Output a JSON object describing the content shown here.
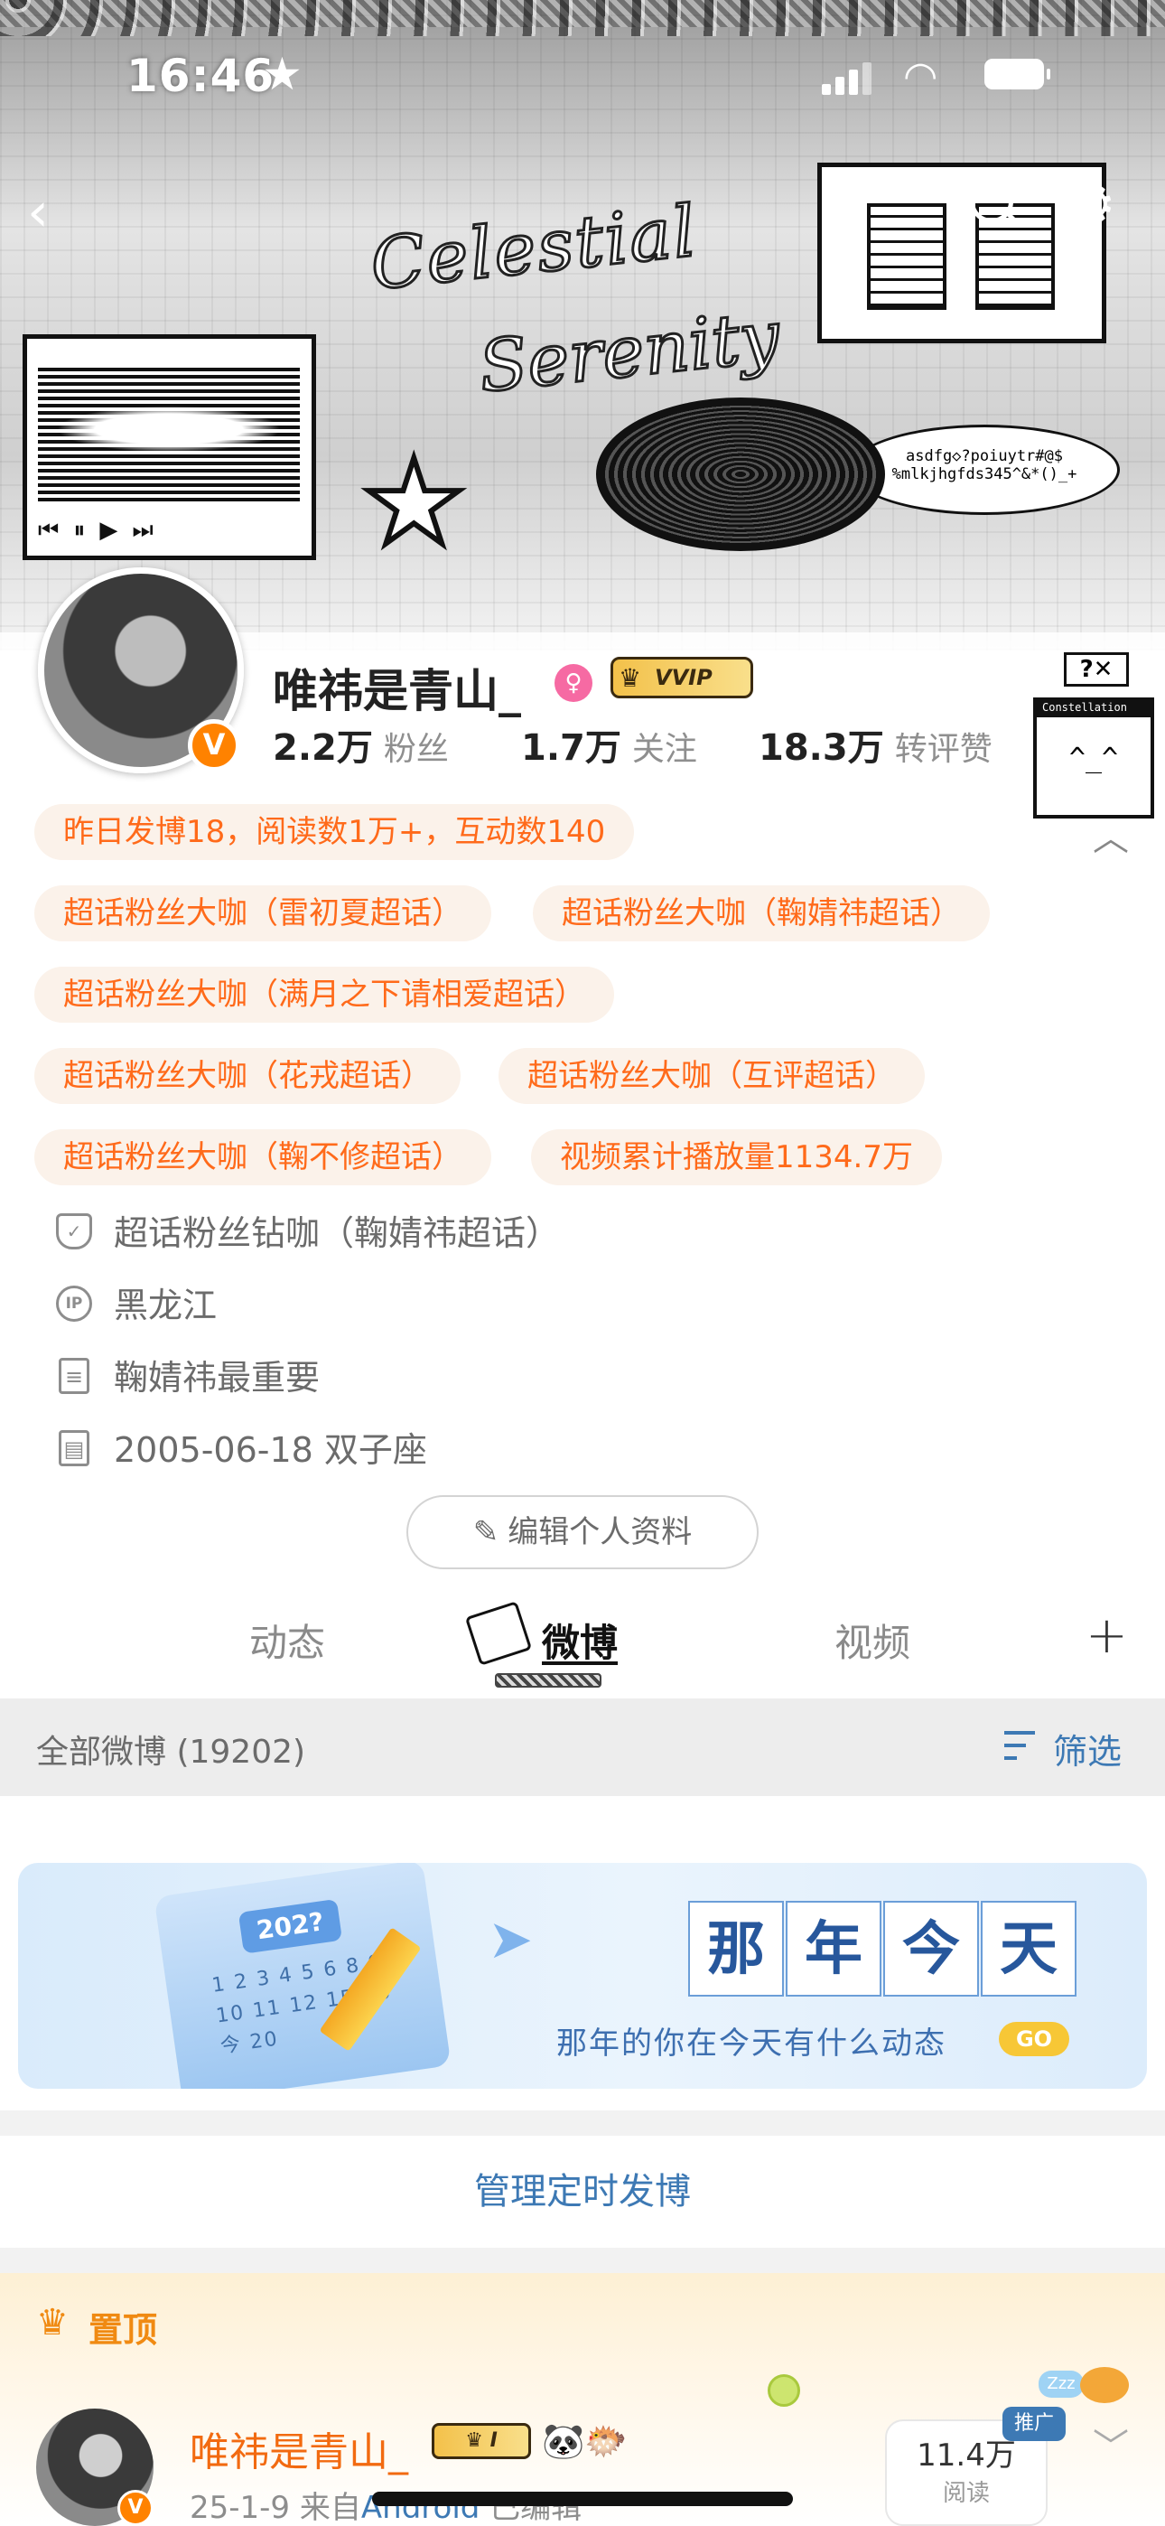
{
  "status_bar": {
    "time": "16:46"
  },
  "banner": {
    "title_line1": "Celestial",
    "title_line2": "Serenity",
    "speech_bubble": "asdfg◇?poiuytr#@$ %mlkjhgfds345^&*()_+",
    "mini_window_title": "Constellation",
    "mini_window_face": "^_^"
  },
  "profile": {
    "nickname": "唯祎是青山_",
    "badge_v": "V",
    "vip_label": "VVIP",
    "stats": [
      {
        "value": "2.2万",
        "label": "粉丝"
      },
      {
        "value": "1.7万",
        "label": "关注"
      },
      {
        "value": "18.3万",
        "label": "转评赞"
      }
    ],
    "activity": "昨日发博18，阅读数1万+，互动数140",
    "tags": [
      "超话粉丝大咖（雷初夏超话）",
      "超话粉丝大咖（鞠婧祎超话）",
      "超话粉丝大咖（满月之下请相爱超话）",
      "超话粉丝大咖（花戎超话）",
      "超话粉丝大咖（互评超话）",
      "超话粉丝大咖（鞠不修超话）",
      "视频累计播放量1134.7万"
    ],
    "info": [
      {
        "icon": "shield-icon",
        "text": "超话粉丝钻咖（鞠婧祎超话）"
      },
      {
        "icon": "ip-icon",
        "text": "黑龙江",
        "icon_text": "IP"
      },
      {
        "icon": "document-icon",
        "text": "鞠婧祎最重要"
      },
      {
        "icon": "calendar-icon",
        "text": "2005-06-18 双子座"
      }
    ],
    "edit_button": "编辑个人资料"
  },
  "tabs": [
    "动态",
    "微博",
    "视频"
  ],
  "active_tab": 1,
  "filter": {
    "all_posts": "全部微博 (19202)",
    "filter_label": "筛选"
  },
  "memory": {
    "year": "202?",
    "calendar_nums": "1 2 3 4 5 6 8 9 10 11 12 15 16 今 20",
    "chars": [
      "那",
      "年",
      "今",
      "天"
    ],
    "subtitle": "那年的你在今天有什么动态",
    "go": "GO"
  },
  "schedule": "管理定时发博",
  "pinned": {
    "label": "置顶",
    "post": {
      "author": "唯祎是青山_",
      "badge": "I",
      "emoji": "🐼🐡",
      "date": "25-1-9",
      "source_prefix": "来自",
      "source": "Android",
      "edited": "已编辑",
      "reads_value": "11.4万",
      "reads_label": "阅读",
      "promo": "推广",
      "zzz": "Zzz"
    }
  }
}
